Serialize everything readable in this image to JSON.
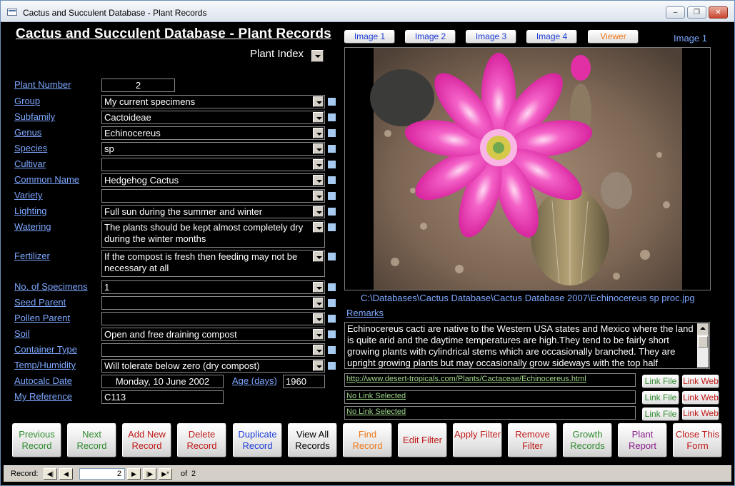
{
  "window": {
    "title": "Cactus and Succulent Database - Plant Records"
  },
  "form": {
    "heading": "Cactus and Succulent Database - Plant Records",
    "plant_index_label": "Plant Index"
  },
  "fields": [
    {
      "label": "Plant Number",
      "value": "2"
    },
    {
      "label": "Group",
      "value": "My current specimens"
    },
    {
      "label": "Subfamily",
      "value": "Cactoideae"
    },
    {
      "label": "Genus",
      "value": "Echinocereus"
    },
    {
      "label": "Species",
      "value": "sp"
    },
    {
      "label": "Cultivar",
      "value": ""
    },
    {
      "label": "Common Name",
      "value": "Hedgehog Cactus"
    },
    {
      "label": "Variety",
      "value": ""
    },
    {
      "label": "Lighting",
      "value": "Full sun during the summer and winter"
    },
    {
      "label": "Watering",
      "value": "The plants should be kept almost completely dry during the winter months"
    },
    {
      "label": "Fertilizer",
      "value": "If the compost is fresh then feeding may not be necessary at all"
    },
    {
      "label": "No. of Specimens",
      "value": "1"
    },
    {
      "label": "Seed Parent",
      "value": ""
    },
    {
      "label": "Pollen Parent",
      "value": ""
    },
    {
      "label": "Soil",
      "value": "Open and free draining compost"
    },
    {
      "label": "Container Type",
      "value": ""
    },
    {
      "label": "Temp/Humidity",
      "value": "Will tolerate below zero (dry compost)"
    },
    {
      "label": "Autocalc Date",
      "value": "Monday, 10 June 2002"
    },
    {
      "label": "My Reference",
      "value": "C113"
    }
  ],
  "age": {
    "label": "Age (days)",
    "value": "1960"
  },
  "images": {
    "buttons": [
      "Image 1",
      "Image 2",
      "Image 3",
      "Image 4",
      "Viewer"
    ],
    "current_label": "Image 1",
    "path": "C:\\Databases\\Cactus Database\\Cactus Database 2007\\Echinocereus sp proc.jpg"
  },
  "remarks": {
    "label": "Remarks",
    "text": "Echinocereus cacti are native to the Western USA states and Mexico where the land is quite arid and the daytime temperatures are high.They tend to be fairly short growing plants with cylindrical stems which are occasionally branched. They are upright growing plants but may occasionally grow sideways with the top half"
  },
  "links": [
    {
      "value": "http://www.desert-tropicals.com/Plants/Cactaceae/Echinocereus.html",
      "file_btn": "Link File",
      "web_btn": "Link Web"
    },
    {
      "value": "No Link Selected",
      "file_btn": "Link File",
      "web_btn": "Link Web"
    },
    {
      "value": "No Link Selected",
      "file_btn": "Link File",
      "web_btn": "Link Web"
    }
  ],
  "actions": [
    {
      "label": "Previous Record",
      "color": "#2e8b2e"
    },
    {
      "label": "Next Record",
      "color": "#2e8b2e"
    },
    {
      "label": "Add New Record",
      "color": "#c01818"
    },
    {
      "label": "Delete Record",
      "color": "#c01818"
    },
    {
      "label": "Duplicate Record",
      "color": "#1c3cd8"
    },
    {
      "label": "View All Records",
      "color": "#000000"
    },
    {
      "label": "Find Record",
      "color": "#f07818"
    },
    {
      "label": "Edit Filter",
      "color": "#c01818"
    },
    {
      "label": "Apply Filter",
      "color": "#c01818"
    },
    {
      "label": "Remove Filter",
      "color": "#c01818"
    },
    {
      "label": "Growth Records",
      "color": "#2e8b2e"
    },
    {
      "label": "Plant Report",
      "color": "#8a1c8a"
    },
    {
      "label": "Close This Form",
      "color": "#c01818"
    }
  ],
  "navigation": {
    "label": "Record:",
    "current": "2",
    "of_label": "of",
    "total": "2"
  },
  "colors": {
    "background": "#000000",
    "label_link": "#7da7ff",
    "link_text": "#9fd48a",
    "field_text": "#ffffff"
  }
}
